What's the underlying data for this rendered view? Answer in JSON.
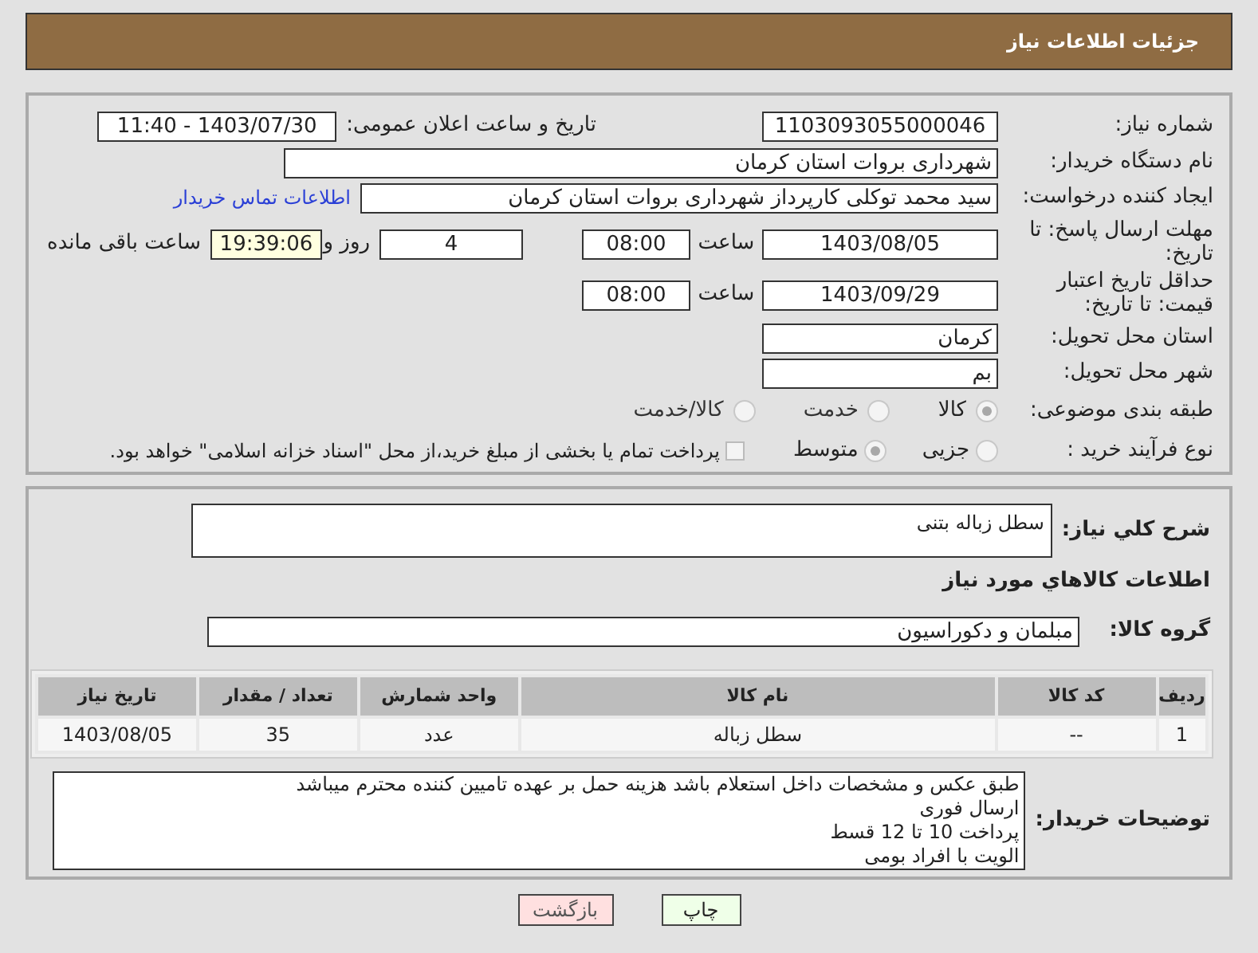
{
  "header": {
    "title": "جزئیات اطلاعات نیاز"
  },
  "need_info": {
    "need_number": {
      "label": "شماره نیاز:",
      "value": "1103093055000046"
    },
    "announce": {
      "label": "تاریخ و ساعت اعلان عمومی:",
      "value": "1403/07/30 - 11:40"
    },
    "buyer_org": {
      "label": "نام دستگاه خریدار:",
      "value": "شهرداری بروات استان کرمان"
    },
    "requester": {
      "label": "ایجاد کننده درخواست:",
      "value": "سید محمد توکلی کارپرداز شهرداری بروات استان کرمان",
      "contact_link": "اطلاعات تماس خریدار"
    },
    "deadline": {
      "label": "مهلت ارسال پاسخ: تا تاریخ:",
      "date": "1403/08/05",
      "time_label": "ساعت",
      "time": "08:00",
      "days": "4",
      "days_label": "روز و",
      "remaining": "19:39:06",
      "remaining_label": "ساعت باقی مانده"
    },
    "validity": {
      "label": "حداقل تاریخ اعتبار قیمت: تا تاریخ:",
      "date": "1403/09/29",
      "time_label": "ساعت",
      "time": "08:00"
    },
    "province": {
      "label": "استان محل تحویل:",
      "value": "کرمان"
    },
    "city": {
      "label": "شهر محل تحویل:",
      "value": "بم"
    },
    "category": {
      "label": "طبقه بندی موضوعی:",
      "options": [
        {
          "label": "کالا",
          "selected": true
        },
        {
          "label": "خدمت",
          "selected": false
        },
        {
          "label": "کالا/خدمت",
          "selected": false
        }
      ]
    },
    "purchase_process": {
      "label": "نوع فرآیند خرید :",
      "options": [
        {
          "label": "جزیی",
          "selected": false
        },
        {
          "label": "متوسط",
          "selected": true
        }
      ],
      "note": {
        "checked": false,
        "text": "پرداخت تمام یا بخشی از مبلغ خرید،از محل \"اسناد خزانه اسلامی\" خواهد بود."
      }
    }
  },
  "details": {
    "description": {
      "label": "شرح کلي نياز:",
      "value": "سطل زباله بتنی"
    },
    "goods_title": "اطلاعات کالاهاي مورد نياز",
    "goods_group": {
      "label": "گروه کالا:",
      "value": "مبلمان و دکوراسیون"
    },
    "table": {
      "columns": [
        "ردیف",
        "کد کالا",
        "نام کالا",
        "واحد شمارش",
        "تعداد / مقدار",
        "تاریخ نیاز"
      ],
      "rows": [
        [
          "1",
          "--",
          "سطل زباله",
          "عدد",
          "35",
          "1403/08/05"
        ]
      ]
    },
    "buyer_notes": {
      "label": "توضیحات خریدار:",
      "value": "طبق عکس و مشخصات داخل استعلام باشد هزینه حمل بر عهده تامیین کننده محترم میباشد\nارسال فوری\nپرداخت 10 تا 12 قسط\nالویت با افراد بومی"
    }
  },
  "buttons": [
    {
      "label": "چاپ",
      "kind": "print"
    },
    {
      "label": "بازگشت",
      "kind": "back"
    }
  ]
}
